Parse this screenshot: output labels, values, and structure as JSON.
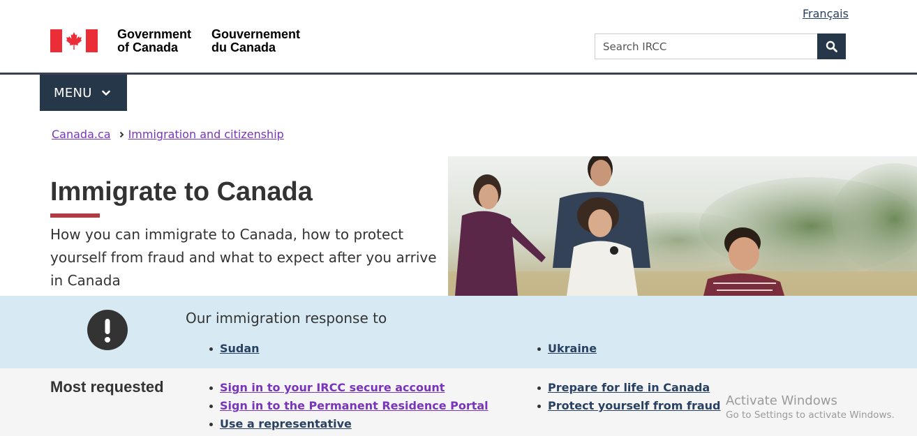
{
  "header": {
    "signature_en_line1": "Government",
    "signature_en_line2": "of Canada",
    "signature_fr_line1": "Gouvernement",
    "signature_fr_line2": "du Canada",
    "language_link": "Français",
    "search_placeholder": "Search IRCC"
  },
  "menu": {
    "label": "MENU"
  },
  "breadcrumb": [
    {
      "label": "Canada.ca"
    },
    {
      "label": "Immigration and citizenship"
    }
  ],
  "hero": {
    "title": "Immigrate to Canada",
    "description": "How you can immigrate to Canada, how to protect yourself from fraud and what to expect after you arrive in Canada"
  },
  "alert": {
    "heading": "Our immigration response to",
    "links_left": [
      {
        "label": "Sudan"
      }
    ],
    "links_right": [
      {
        "label": "Ukraine"
      }
    ]
  },
  "most_requested": {
    "heading": "Most requested",
    "links_left": [
      {
        "label": "Sign in to your IRCC secure account"
      },
      {
        "label": "Sign in to the Permanent Residence Portal"
      },
      {
        "label": "Use a representative"
      }
    ],
    "links_right": [
      {
        "label": "Prepare for life in Canada"
      },
      {
        "label": "Protect yourself from fraud"
      }
    ]
  },
  "watermark": {
    "line1": "Activate Windows",
    "line2": "Go to Settings to activate Windows."
  },
  "colors": {
    "brand_navy": "#26374a",
    "link": "#284162",
    "visited_link": "#7834bc",
    "accent_red": "#af3c43",
    "alert_bg": "#d7eaf3",
    "section_bg": "#f5f5f5",
    "flag_red": "#eb2d37"
  },
  "icons": {
    "search": "search-icon",
    "menu_chevron": "chevron-down-icon",
    "breadcrumb_sep": "chevron-right-icon",
    "alert": "exclamation-circle-icon"
  }
}
